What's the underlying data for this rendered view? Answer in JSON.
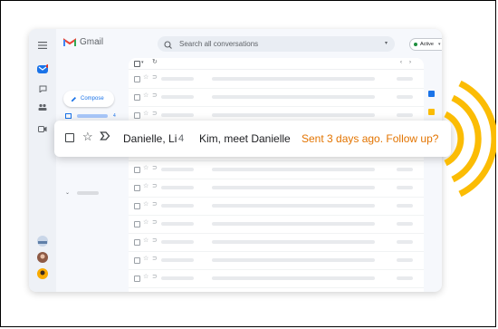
{
  "app": {
    "name": "Gmail"
  },
  "search": {
    "placeholder": "Search all conversations"
  },
  "status": {
    "label": "Active",
    "color": "#1e8e3e"
  },
  "compose": {
    "label": "Compose"
  },
  "nav": {
    "inbox_count": "4"
  },
  "highlight": {
    "sender": "Danielle, Li",
    "count": "4",
    "subject": "Kim, meet Danielle",
    "nudge": "Sent 3 days ago. Follow up?",
    "nudge_color": "#e37400"
  },
  "icons": {
    "star": "☆",
    "tag": "⊃"
  },
  "colors": {
    "accent": "#1a73e8",
    "nudge_arcs": "#fbbc04"
  }
}
